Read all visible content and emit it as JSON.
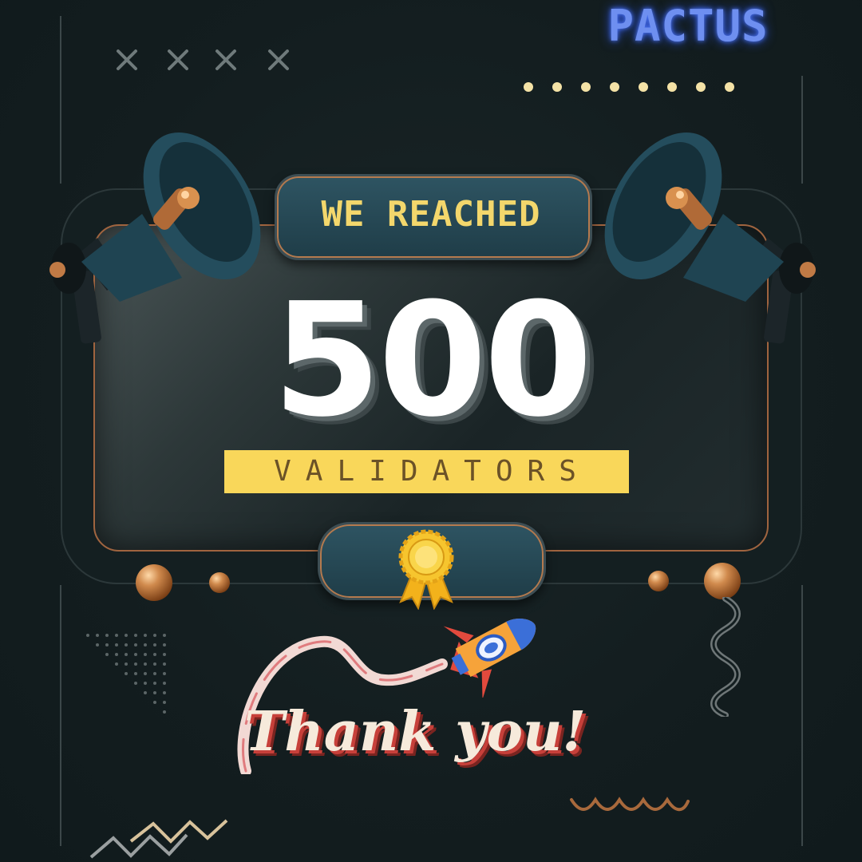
{
  "brand": {
    "name": "PACTUS",
    "color": "#6e8ff0"
  },
  "announcement": {
    "headline": "WE REACHED",
    "count": "500",
    "label": "VALIDATORS",
    "thanks": "Thank you!"
  },
  "colors": {
    "background": "#131e20",
    "headline": "#f3d76c",
    "label_band": "#f9d75a",
    "label_text": "#6b5227",
    "copper_accent": "#c07a45",
    "thanks_shadow": "#c7403a"
  },
  "decorations": {
    "icons": [
      "megaphone-icon",
      "award-ribbon-icon",
      "rocket-icon"
    ],
    "cross_marks": 4,
    "dot_row": 8
  }
}
